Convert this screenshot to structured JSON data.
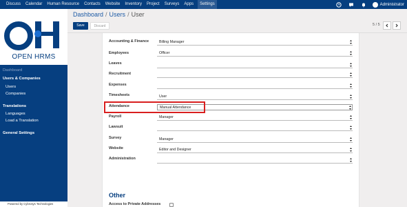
{
  "topbar": {
    "menu": [
      "Discuss",
      "Calendar",
      "Human Resource",
      "Contacts",
      "Website",
      "Inventory",
      "Project",
      "Surveys",
      "Apps",
      "Settings"
    ],
    "active_index": 9,
    "user_name": "Administrator"
  },
  "sidebar": {
    "logo_text": "OPEN HRMS",
    "items": {
      "dashboard": "Dashboard",
      "users_companies": "Users & Companies",
      "users": "Users",
      "companies": "Companies",
      "translations": "Translations",
      "languages": "Languages",
      "load_translation": "Load a Translation",
      "general_settings": "General Settings"
    },
    "powered": "Powered by Cybrosys Technologies"
  },
  "breadcrumb": {
    "dashboard": "Dashboard",
    "users": "Users",
    "current": "User"
  },
  "toolbar": {
    "save_label": "Save",
    "discard_label": "Discard"
  },
  "pager": {
    "text": "5 / 5"
  },
  "form": {
    "accounting_label": "Accounting & Finance",
    "accounting_value": "Billing Manager",
    "employees_label": "Employees",
    "employees_value": "Officer",
    "leaves_label": "Leaves",
    "leaves_value": "",
    "recruitment_label": "Recruitment",
    "recruitment_value": "",
    "expenses_label": "Expenses",
    "expenses_value": "",
    "timesheets_label": "Timesheets",
    "timesheets_value": "User",
    "attendance_label": "Attendance",
    "attendance_value": "Manual Attendance",
    "payroll_label": "Payroll",
    "payroll_value": "Manager",
    "lawsuit_label": "Lawsuit",
    "lawsuit_value": "",
    "survey_label": "Survey",
    "survey_value": "Manager",
    "website_label": "Website",
    "website_value": "Editor and Designer",
    "administration_label": "Administration",
    "administration_value": "",
    "other_title": "Other",
    "private_addresses_label": "Access to Private Addresses"
  },
  "colors": {
    "brand": "#063f80",
    "highlight": "#d81e1e"
  }
}
